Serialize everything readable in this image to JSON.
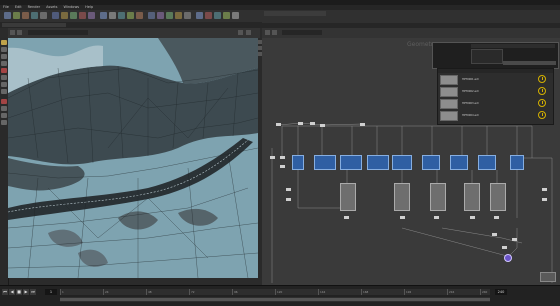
{
  "window": {
    "title": ""
  },
  "menus": [
    "File",
    "Edit",
    "Render",
    "Assets",
    "Windows",
    "Help"
  ],
  "viewport": {
    "status_line": "",
    "right_tools": []
  },
  "network": {
    "title": "Geometry",
    "tabs": [],
    "info_panel": {
      "title": "",
      "field_value": "",
      "menu_items": [
        "",
        ""
      ],
      "button_label": ""
    },
    "files": [
      {
        "name": "HPT0001.ext"
      },
      {
        "name": "HPT0002.ext"
      },
      {
        "name": "HPT0003.ext"
      },
      {
        "name": "HPT0004.ext"
      }
    ]
  },
  "timeline": {
    "current_frame": "1",
    "end_frame": "240",
    "ticks": [
      "1",
      "24",
      "48",
      "72",
      "96",
      "120",
      "144",
      "168",
      "192",
      "216",
      "240"
    ],
    "auto_update": ""
  },
  "colors": {
    "viewport_bg": "#7ea3b0",
    "node_blue": "#2f5fa3",
    "node_gray": "#6e6e6e",
    "purple_node": "#6a54c9",
    "status_yellow": "#d4b000"
  }
}
